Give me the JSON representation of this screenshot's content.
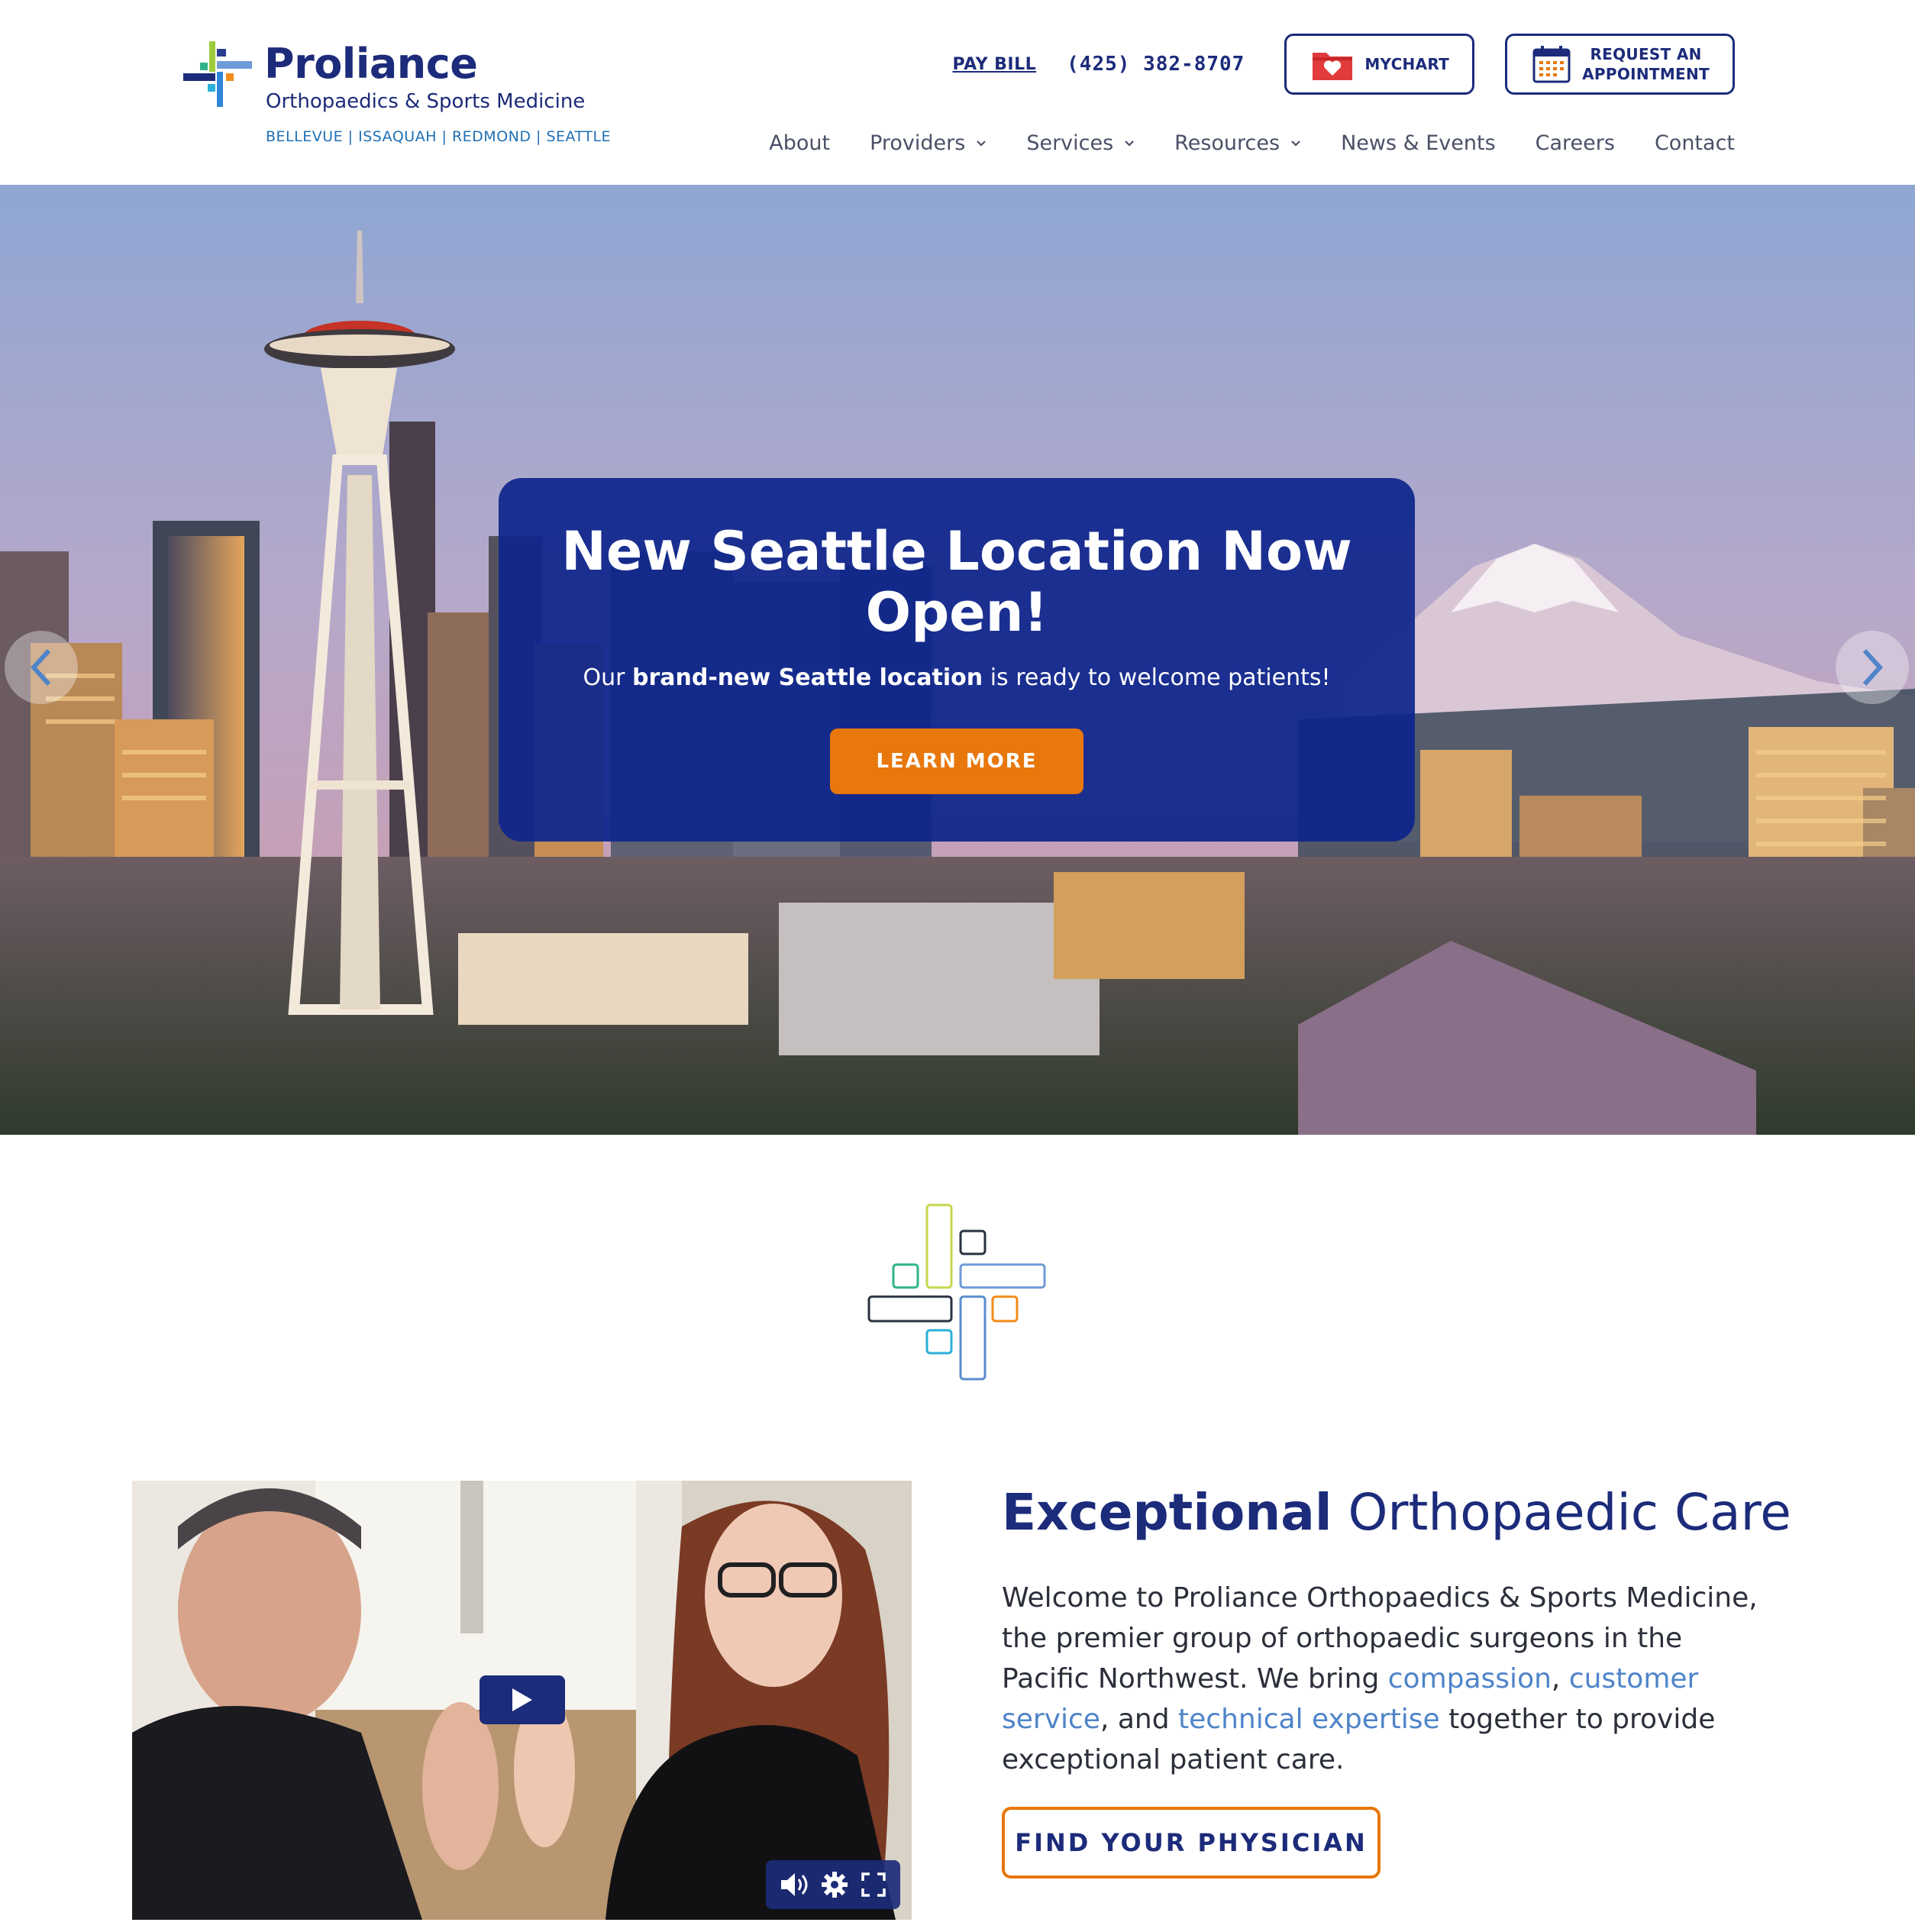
{
  "header": {
    "logo": {
      "name": "Proliance",
      "subtitle": "Orthopaedics & Sports Medicine",
      "locations": "BELLEVUE | ISSAQUAH | REDMOND | SEATTLE"
    },
    "utility": {
      "pay_bill": "PAY BILL",
      "phone": "(425) 382-8707",
      "mychart": "MYCHART",
      "request_line1": "REQUEST AN",
      "request_line2": "APPOINTMENT"
    },
    "nav": [
      {
        "label": "About",
        "dropdown": false
      },
      {
        "label": "Providers",
        "dropdown": true
      },
      {
        "label": "Services",
        "dropdown": true
      },
      {
        "label": "Resources",
        "dropdown": true
      },
      {
        "label": "News & Events",
        "dropdown": false
      },
      {
        "label": "Careers",
        "dropdown": false
      },
      {
        "label": "Contact",
        "dropdown": false
      }
    ]
  },
  "hero": {
    "title": "New Seattle Location Now Open!",
    "text_prefix": "Our",
    "text_bold": "brand-new Seattle location",
    "text_suffix": "is ready to welcome patients!",
    "button": "LEARN MORE",
    "prev_icon": "chevron-left-icon",
    "next_icon": "chevron-right-icon"
  },
  "about": {
    "title_strong": "Exceptional",
    "title_rest": "Orthopaedic Care",
    "body_1": "Welcome to Proliance Orthopaedics & Sports Medicine, the premier group of orthopaedic surgeons in the Pacific Northwest. We bring",
    "link_1": "compassion",
    "sep_1": ",",
    "link_2": "customer service",
    "body_2": ", and",
    "link_3": "technical expertise",
    "body_3": "together to provide exceptional patient care.",
    "button": "FIND YOUR PHYSICIAN"
  },
  "video": {
    "play_icon": "play-icon",
    "controls": [
      "volume-icon",
      "settings-gear-icon",
      "fullscreen-icon"
    ]
  },
  "colors": {
    "brand_navy": "#1c2b7a",
    "accent_orange": "#e8770c",
    "link_blue": "#4f84c9",
    "hero_card": "#0e268c"
  }
}
